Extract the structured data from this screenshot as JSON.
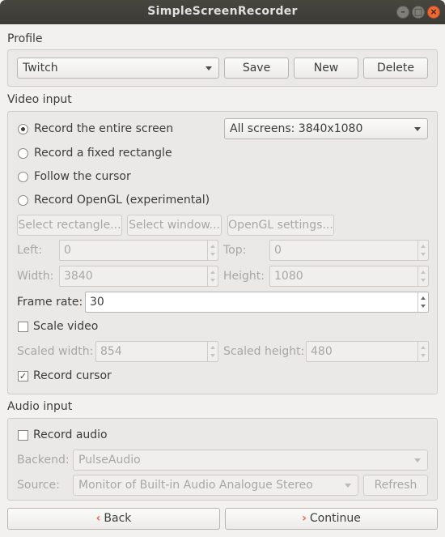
{
  "window": {
    "title": "SimpleScreenRecorder",
    "controls": {
      "minimize": "–",
      "maximize": "□",
      "close": "×"
    }
  },
  "profile": {
    "section_label": "Profile",
    "selected": "Twitch",
    "save_label": "Save",
    "new_label": "New",
    "delete_label": "Delete"
  },
  "video": {
    "section_label": "Video input",
    "options": [
      {
        "label": "Record the entire screen",
        "selected": true
      },
      {
        "label": "Record a fixed rectangle",
        "selected": false
      },
      {
        "label": "Follow the cursor",
        "selected": false
      },
      {
        "label": "Record OpenGL (experimental)",
        "selected": false
      }
    ],
    "screen_select": "All screens: 3840x1080",
    "select_rectangle_label": "Select rectangle...",
    "select_window_label": "Select window...",
    "opengl_settings_label": "OpenGL settings...",
    "left_label": "Left:",
    "left_value": "0",
    "top_label": "Top:",
    "top_value": "0",
    "width_label": "Width:",
    "width_value": "3840",
    "height_label": "Height:",
    "height_value": "1080",
    "frame_rate_label": "Frame rate:",
    "frame_rate_value": "30",
    "scale_video_label": "Scale video",
    "scale_video_checked": false,
    "scaled_width_label": "Scaled width:",
    "scaled_width_value": "854",
    "scaled_height_label": "Scaled height:",
    "scaled_height_value": "480",
    "record_cursor_label": "Record cursor",
    "record_cursor_checked": true,
    "check_mark": "✓"
  },
  "audio": {
    "section_label": "Audio input",
    "record_audio_label": "Record audio",
    "record_audio_checked": false,
    "backend_label": "Backend:",
    "backend_value": "PulseAudio",
    "source_label": "Source:",
    "source_value": "Monitor of Built-in Audio Analogue Stereo",
    "refresh_label": "Refresh"
  },
  "footer": {
    "back_label": "Back",
    "back_icon": "‹",
    "continue_label": "Continue",
    "continue_icon": "›"
  },
  "colors": {
    "accent": "#e9693b",
    "titlebar": "#3b3a35"
  }
}
